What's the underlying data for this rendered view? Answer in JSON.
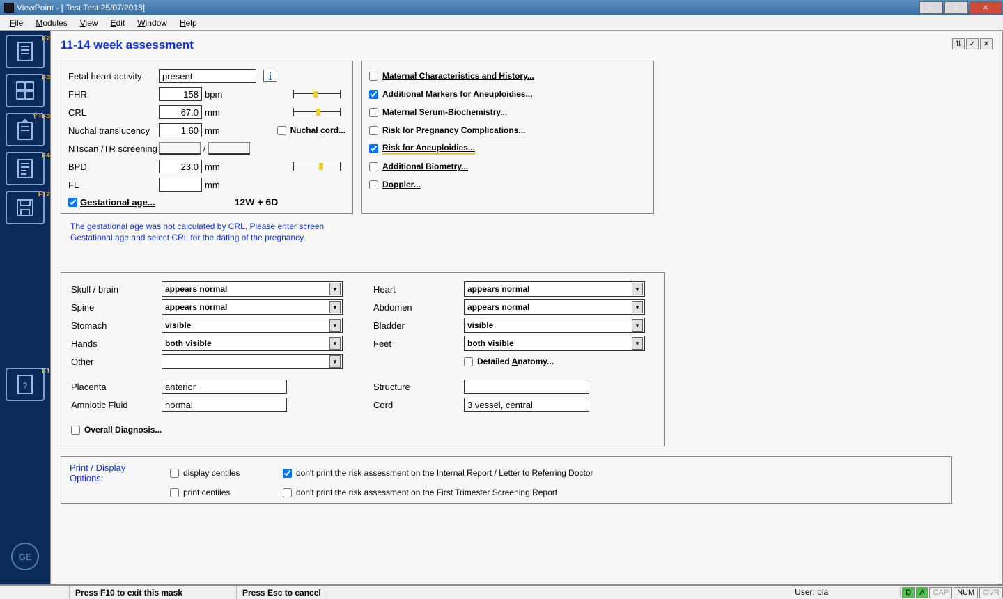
{
  "window": {
    "title": "ViewPoint - [ Test Test 25/07/2018]"
  },
  "menu": {
    "file": "File",
    "modules": "Modules",
    "view": "View",
    "edit": "Edit",
    "window": "Window",
    "help": "Help"
  },
  "sidebar": {
    "f2": "F2",
    "f3": "F3",
    "upf3": "⇧+F3",
    "f4": "F4",
    "f12": "F12",
    "f1": "F1"
  },
  "page": {
    "title": "11-14 week assessment"
  },
  "measurements": {
    "fetal_heart_label": "Fetal heart activity",
    "fetal_heart_value": "present",
    "fhr_label": "FHR",
    "fhr_value": "158",
    "fhr_unit": "bpm",
    "crl_label": "CRL",
    "crl_value": "67.0",
    "crl_unit": "mm",
    "nt_label": "Nuchal translucency",
    "nt_value": "1.60",
    "nt_unit": "mm",
    "nuchal_cord": "Nuchal cord...",
    "ntscan_label": "NTscan /TR screening",
    "bpd_label": "BPD",
    "bpd_value": "23.0",
    "bpd_unit": "mm",
    "fl_label": "FL",
    "fl_value": "",
    "fl_unit": "mm",
    "ga_label": "Gestational age...",
    "ga_value": "12W + 6D"
  },
  "checks": {
    "maternal_char": "Maternal Characteristics and History...",
    "add_markers": "Additional Markers for Aneuploidies...",
    "serum": "Maternal Serum-Biochemistry...",
    "preg_comp": "Risk for Pregnancy Complications...",
    "aneu_risk": "Risk for Aneuploidies...",
    "add_biom": "Additional Biometry...",
    "doppler": "Doppler..."
  },
  "warning": {
    "l1": "The gestational age was not calculated by CRL. Please enter screen",
    "l2": "Gestational age and select CRL for the dating of the pregnancy."
  },
  "anatomy": {
    "skull_label": "Skull / brain",
    "skull_value": "appears normal",
    "spine_label": "Spine",
    "spine_value": "appears normal",
    "stomach_label": "Stomach",
    "stomach_value": "visible",
    "hands_label": "Hands",
    "hands_value": "both visible",
    "other_label": "Other",
    "other_value": "",
    "heart_label": "Heart",
    "heart_value": "appears normal",
    "abdomen_label": "Abdomen",
    "abdomen_value": "appears normal",
    "bladder_label": "Bladder",
    "bladder_value": "visible",
    "feet_label": "Feet",
    "feet_value": "both visible",
    "detailed": "Detailed Anatomy...",
    "placenta_label": "Placenta",
    "placenta_value": "anterior",
    "amniotic_label": "Amniotic Fluid",
    "amniotic_value": "normal",
    "structure_label": "Structure",
    "structure_value": "",
    "cord_label": "Cord",
    "cord_value": "3 vessel, central",
    "overall": "Overall Diagnosis..."
  },
  "print": {
    "label": "Print / Display Options:",
    "disp_centiles": "display centiles",
    "print_centiles": "print centiles",
    "no_internal": "don't print the risk assessment on the Internal Report / Letter to Referring Doctor",
    "no_screening": "don't print the risk assessment on the First Trimester Screening Report"
  },
  "status": {
    "f10": "Press F10 to exit this mask",
    "esc": "Press Esc to cancel",
    "user": "User: pia",
    "d": "D",
    "a": "A",
    "cap": "CAP",
    "num": "NUM",
    "ovr": "OVR"
  }
}
